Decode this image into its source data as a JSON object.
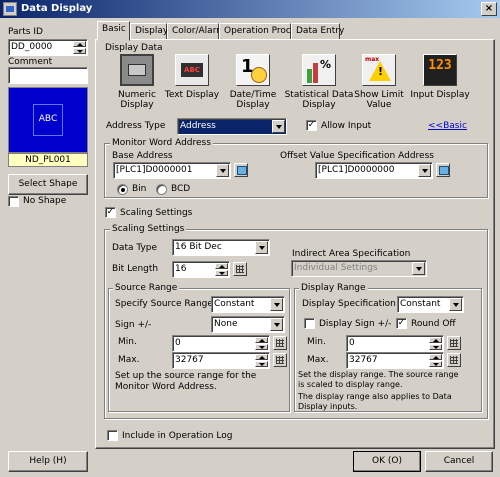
{
  "window": {
    "title": "Data Display"
  },
  "left": {
    "parts_id_label": "Parts ID",
    "parts_id_value": "DD_0000",
    "comment_label": "Comment",
    "comment_value": "",
    "preview_text": "ABC",
    "shape_name": "ND_PL001",
    "select_shape_label": "Select Shape",
    "no_shape_label": "No Shape",
    "no_shape_checked": false
  },
  "tabs": [
    "Basic",
    "Display",
    "Color/Alarm",
    "Operation Process",
    "Data Entry"
  ],
  "active_tab": "Basic",
  "display_data": {
    "label": "Display Data",
    "types": [
      {
        "label": "Numeric Display",
        "icon": "numeric-display-icon"
      },
      {
        "label": "Text Display",
        "icon": "text-display-icon"
      },
      {
        "label": "Date/Time Display",
        "icon": "datetime-display-icon"
      },
      {
        "label": "Statistical Data Display",
        "icon": "statistical-display-icon"
      },
      {
        "label": "Show Limit Value",
        "icon": "limit-value-icon"
      },
      {
        "label": "Input Display",
        "icon": "input-display-icon"
      }
    ]
  },
  "address": {
    "type_label": "Address Type",
    "type_value": "Address",
    "allow_input_label": "Allow Input",
    "allow_input_checked": true,
    "basic_link": "<<Basic"
  },
  "monitor": {
    "group_label": "Monitor Word Address",
    "base_label": "Base Address",
    "base_value": "[PLC1]D0000001",
    "offset_label": "Offset Value Specification Address",
    "offset_value": "[PLC1]D0000000",
    "bin_label": "Bin",
    "bcd_label": "BCD",
    "selected_format": "Bin"
  },
  "scaling": {
    "checkbox_label": "Scaling Settings",
    "checked": true,
    "group_label": "Scaling Settings",
    "data_type_label": "Data Type",
    "data_type_value": "16 Bit Dec",
    "bit_length_label": "Bit Length",
    "bit_length_value": "16",
    "indirect_label": "Indirect Area Specification",
    "indirect_value": "Individual Settings"
  },
  "source": {
    "group_label": "Source Range",
    "specify_label": "Specify Source Range",
    "specify_value": "Constant",
    "sign_label": "Sign +/-",
    "sign_value": "None",
    "min_label": "Min.",
    "min_value": "0",
    "max_label": "Max.",
    "max_value": "32767",
    "note": "Set up the source range for the\nMonitor Word Address."
  },
  "display_range": {
    "group_label": "Display Range",
    "spec_label": "Display Specification",
    "spec_value": "Constant",
    "sign_label": "Display Sign +/-",
    "sign_checked": false,
    "round_off_label": "Round Off",
    "round_off_checked": true,
    "min_label": "Min.",
    "min_value": "0",
    "max_label": "Max.",
    "max_value": "32767",
    "note1": "Set the display range. The source range\nis scaled to display range.",
    "note2": "The display range also applies to Data\nDisplay inputs."
  },
  "include_log": {
    "label": "Include in Operation Log",
    "checked": false
  },
  "buttons": {
    "help": "Help (H)",
    "ok": "OK (O)",
    "cancel": "Cancel"
  },
  "colors": {
    "title_start": "#0a246a",
    "title_end": "#a6caf0",
    "preview_bg": "#0000cc",
    "shape_name_bg": "#ffffc0",
    "face": "#d4d0c8"
  }
}
